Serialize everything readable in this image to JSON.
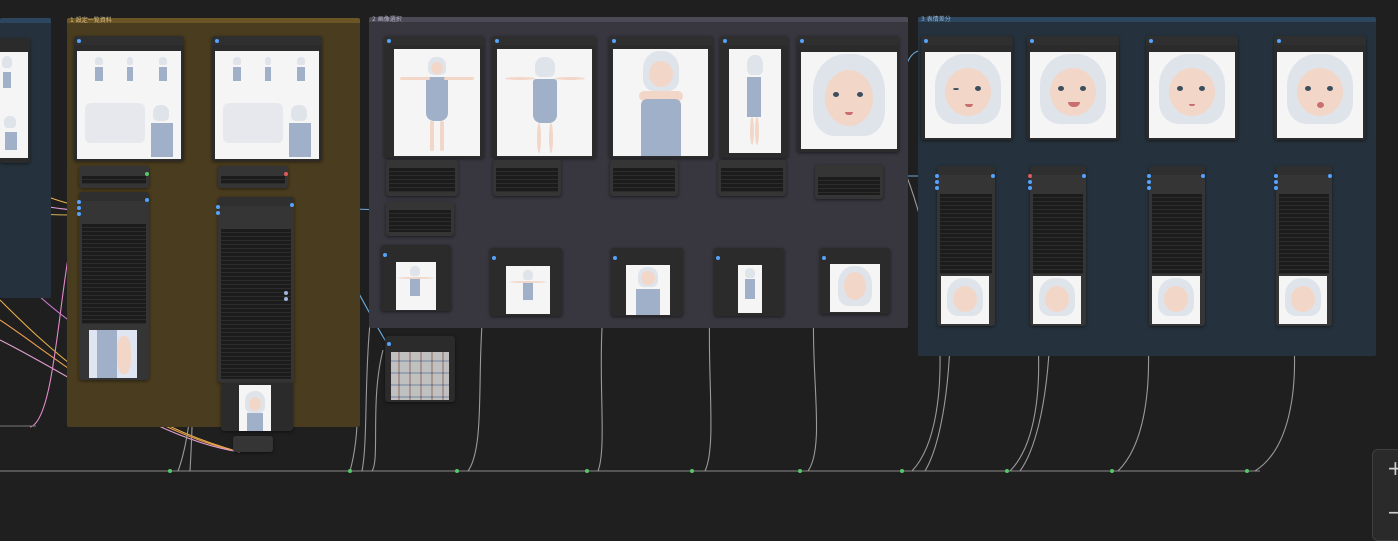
{
  "canvas": {
    "background": "#1f1f1f"
  },
  "groups": [
    {
      "id": "left",
      "title": "",
      "color": "#25323d"
    },
    {
      "id": "gold",
      "title": "1 設定一覧資料",
      "color": "#4a3c1e"
    },
    {
      "id": "grey",
      "title": "2 画像選択",
      "color": "#38363e"
    },
    {
      "id": "blue",
      "title": "3 表情差分",
      "color": "#25323d"
    }
  ],
  "controls": {
    "zoom_in": "+",
    "zoom_out": "−"
  }
}
